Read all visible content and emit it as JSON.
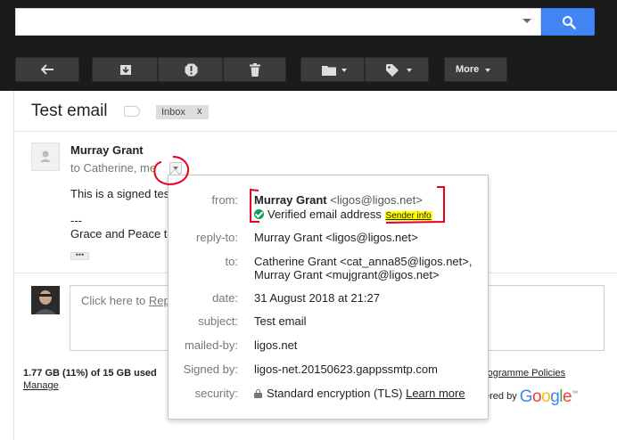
{
  "search": {
    "value": "",
    "placeholder": ""
  },
  "icons": {
    "search": "search-icon",
    "reply": "reply-arrow-icon",
    "archive": "archive-icon",
    "spam": "report-spam-icon",
    "delete": "trash-icon",
    "folder": "folder-icon",
    "labels": "label-tag-icon"
  },
  "toolbar": {
    "more_label": "More"
  },
  "colors": {
    "search_button": "#4285f4",
    "verified": "#0f9d58",
    "highlight": "#ffff00",
    "annotation": "#e8001c"
  },
  "thread": {
    "subject": "Test email",
    "label_chip": "Inbox",
    "label_chip_close": "x"
  },
  "message": {
    "sender": "Murray Grant",
    "recipients": "to Catherine, me",
    "body_line_1": "This is a signed tes",
    "body_line_2": "---",
    "body_line_3": "Grace and Peace to",
    "ellipsis": "•••"
  },
  "reply": {
    "prompt_prefix": "Click here to ",
    "prompt_link": "Rep"
  },
  "details": {
    "from_label": "from:",
    "from_name": "Murray Grant",
    "from_email": "<ligos@ligos.net>",
    "verified_text": "Verified email address",
    "sender_info": "Sender info",
    "reply_to_label": "reply-to:",
    "reply_to": "Murray Grant <ligos@ligos.net>",
    "to_label": "to:",
    "to_line_1": "Catherine Grant <cat_anna85@ligos.net>,",
    "to_line_2": "Murray Grant <mujgrant@ligos.net>",
    "date_label": "date:",
    "date": "31 August 2018 at 21:27",
    "subject_label": "subject:",
    "subject": "Test email",
    "mailed_by_label": "mailed-by:",
    "mailed_by": "ligos.net",
    "signed_by_label": "Signed by:",
    "signed_by": "ligos-net.20150623.gappssmtp.com",
    "security_label": "security:",
    "security": "Standard encryption (TLS)",
    "learn_more": "Learn more"
  },
  "footer": {
    "storage": "1.77 GB (11%) of 15 GB used",
    "manage": "Manage",
    "policies": "rogramme Policies",
    "powered": "ered by",
    "google": "Google",
    "tm": "™"
  }
}
